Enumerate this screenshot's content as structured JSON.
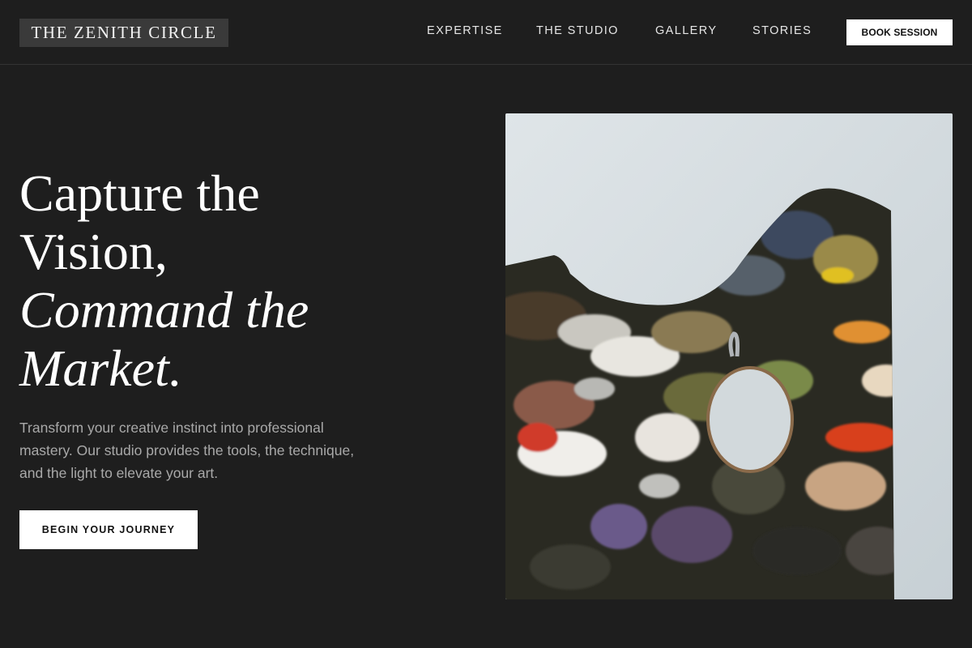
{
  "header": {
    "logo": "THE ZENITH CIRCLE",
    "nav": [
      "EXPERTISE",
      "THE STUDIO",
      "GALLERY",
      "STORIES"
    ],
    "cta": "BOOK SESSION"
  },
  "hero": {
    "title_line1": "Capture the",
    "title_line2": "Vision,",
    "title_line3": "Command the",
    "title_line4": "Market.",
    "description": "Transform your creative instinct into professional mastery. Our studio provides the tools, the technique, and the light to elevate your art.",
    "cta": "BEGIN YOUR JOURNEY",
    "image_subject": "paint-palette-photo"
  },
  "colors": {
    "background": "#1e1e1e",
    "button_bg": "#ffffff",
    "button_text": "#111111",
    "body_text": "#a9a9a9"
  }
}
